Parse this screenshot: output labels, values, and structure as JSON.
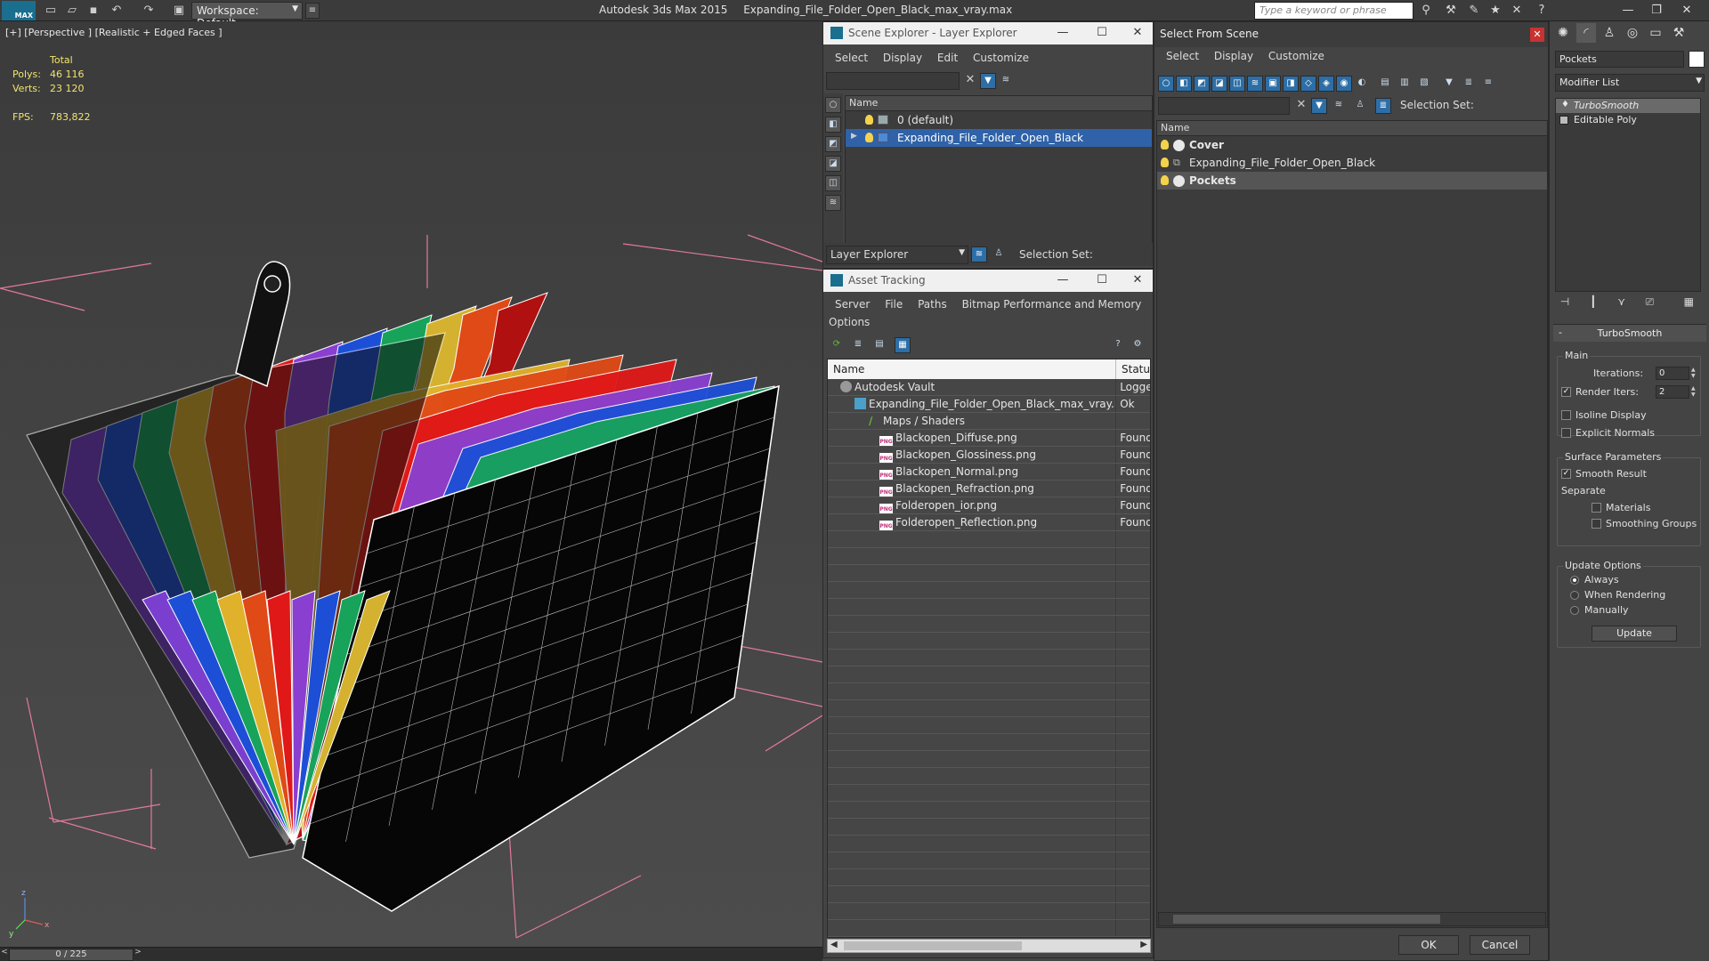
{
  "titlebar": {
    "logo": "MAX",
    "workspace": "Workspace: Default",
    "app_name": "Autodesk 3ds Max  2015",
    "file_name": "Expanding_File_Folder_Open_Black_max_vray.max",
    "search_placeholder": "Type a keyword or phrase"
  },
  "viewport": {
    "label": "[+] [Perspective ] [Realistic + Edged Faces ]",
    "stats": {
      "total_label": "Total",
      "polys_label": "Polys:",
      "polys_value": "46 116",
      "verts_label": "Verts:",
      "verts_value": "23 120",
      "fps_label": "FPS:",
      "fps_value": "783,822"
    },
    "axis": {
      "x": "x",
      "y": "y",
      "z": "z"
    }
  },
  "timeline": {
    "frame": "0 / 225",
    "prev": "<",
    "next": ">"
  },
  "scene_explorer": {
    "title": "Scene Explorer - Layer Explorer",
    "menu": [
      "Select",
      "Display",
      "Edit",
      "Customize"
    ],
    "column": "Name",
    "rows": [
      {
        "label": "0 (default)",
        "selected": false
      },
      {
        "label": "Expanding_File_Folder_Open_Black",
        "selected": true
      }
    ],
    "footer_dropdown": "Layer Explorer",
    "selection_set_label": "Selection Set:"
  },
  "asset_tracking": {
    "title": "Asset Tracking",
    "menu1": [
      "Server",
      "File",
      "Paths",
      "Bitmap Performance and Memory"
    ],
    "menu2": [
      "Options"
    ],
    "columns": {
      "name": "Name",
      "status": "Status"
    },
    "rows": [
      {
        "name": "Autodesk Vault",
        "status": "Logged",
        "indent": 14,
        "icon": "vault"
      },
      {
        "name": "Expanding_File_Folder_Open_Black_max_vray.max",
        "status": "Ok",
        "indent": 30,
        "icon": "file"
      },
      {
        "name": "Maps / Shaders",
        "status": "",
        "indent": 46,
        "icon": "maps"
      },
      {
        "name": "Blackopen_Diffuse.png",
        "status": "Found",
        "indent": 58,
        "icon": "png"
      },
      {
        "name": "Blackopen_Glossiness.png",
        "status": "Found",
        "indent": 58,
        "icon": "png"
      },
      {
        "name": "Blackopen_Normal.png",
        "status": "Found",
        "indent": 58,
        "icon": "png"
      },
      {
        "name": "Blackopen_Refraction.png",
        "status": "Found",
        "indent": 58,
        "icon": "png"
      },
      {
        "name": "Folderopen_ior.png",
        "status": "Found",
        "indent": 58,
        "icon": "png"
      },
      {
        "name": "Folderopen_Reflection.png",
        "status": "Found",
        "indent": 58,
        "icon": "png"
      }
    ],
    "png_badge": "PNG"
  },
  "select_from_scene": {
    "title": "Select From Scene",
    "menu": [
      "Select",
      "Display",
      "Customize"
    ],
    "selection_set_label": "Selection Set:",
    "column": "Name",
    "rows": [
      {
        "label": "Cover",
        "bold": true,
        "highlight": false
      },
      {
        "label": "Expanding_File_Folder_Open_Black",
        "bold": false,
        "highlight": false
      },
      {
        "label": "Pockets",
        "bold": true,
        "highlight": true
      }
    ],
    "ok": "OK",
    "cancel": "Cancel"
  },
  "command_panel": {
    "object_name": "Pockets",
    "modifier_list": "Modifier List",
    "stack": [
      {
        "label": "TurboSmooth",
        "selected": true
      },
      {
        "label": "Editable Poly",
        "selected": false
      }
    ],
    "turbosmooth": {
      "header": "TurboSmooth",
      "main": "Main",
      "iterations_label": "Iterations:",
      "iterations_value": "0",
      "render_iters_label": "Render Iters:",
      "render_iters_value": "2",
      "isoline": "Isoline Display",
      "explicit_normals": "Explicit Normals",
      "surface_params": "Surface Parameters",
      "smooth_result": "Smooth Result",
      "separate": "Separate",
      "materials": "Materials",
      "smoothing_groups": "Smoothing Groups",
      "update_options": "Update Options",
      "always": "Always",
      "when_rendering": "When Rendering",
      "manually": "Manually",
      "update": "Update"
    }
  },
  "colors": {
    "selection_blue": "#2f62a8",
    "stats_yellow": "#f2e46c",
    "pocket_colors": [
      "#7b3fd0",
      "#1d4fd6",
      "#17a35a",
      "#e0b22b",
      "#e04a16",
      "#e01818",
      "#8a3fd0",
      "#1d4fd6",
      "#17a35a",
      "#d4b22f",
      "#e04a16",
      "#b01010"
    ]
  }
}
